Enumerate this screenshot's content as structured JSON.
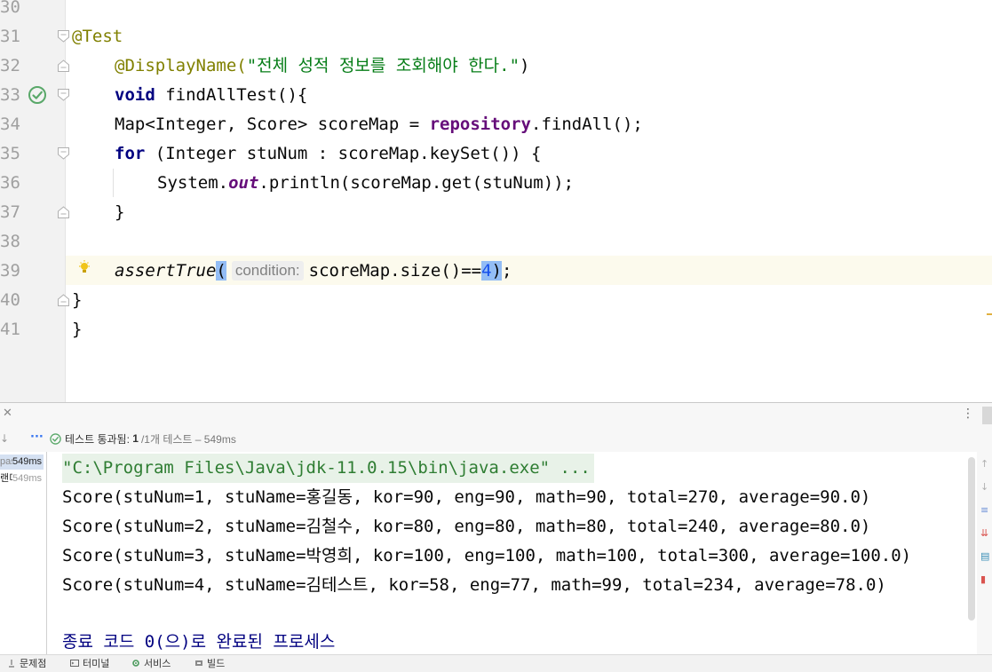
{
  "editor": {
    "line_numbers": [
      "30",
      "31",
      "32",
      "33",
      "34",
      "35",
      "36",
      "37",
      "38",
      "39",
      "40",
      "41"
    ],
    "lines": {
      "l31": {
        "annotation": "@Test"
      },
      "l32": {
        "annotation": "@DisplayName(",
        "string": "\"전체 성적 정보를 조회해야 한다.\"",
        "close": ")"
      },
      "l33": {
        "keyword": "void",
        "rest": " findAllTest(){"
      },
      "l34": {
        "pre": "Map<Integer, Score> scoreMap = ",
        "field": "repository",
        "post": ".findAll();"
      },
      "l35": {
        "keyword": "for",
        "rest": " (Integer stuNum : scoreMap.keySet()) {"
      },
      "l36": {
        "pre": "System.",
        "field": "out",
        "post": ".println(scoreMap.get(stuNum));"
      },
      "l37": {
        "text": "}"
      },
      "l39": {
        "method": "assertTrue",
        "open": "(",
        "hint": "condition:",
        "expr": "scoreMap.size()==",
        "number": "4",
        "close": ")",
        "semi": ";"
      },
      "l40": {
        "text": "}"
      },
      "l41": {
        "text": "}"
      }
    }
  },
  "run_panel": {
    "toolbar": {
      "dots": "···",
      "status_label": "테스트 통과됨:",
      "passed_count": "1",
      "summary": "/1개 테스트 – 549ms"
    },
    "tree": {
      "row1": {
        "name": "pas",
        "time": "549ms"
      },
      "row2": {
        "name": "랜디",
        "time": "549ms"
      }
    },
    "console": {
      "command": "\"C:\\Program Files\\Java\\jdk-11.0.15\\bin\\java.exe\" ...",
      "output": [
        "Score(stuNum=1, stuName=홍길동, kor=90, eng=90, math=90, total=270, average=90.0)",
        "Score(stuNum=2, stuName=김철수, kor=80, eng=80, math=80, total=240, average=80.0)",
        "Score(stuNum=3, stuName=박영희, kor=100, eng=100, math=100, total=300, average=100.0)",
        "Score(stuNum=4, stuName=김테스트, kor=58, eng=77, math=99, total=234, average=78.0)"
      ],
      "exit_message": "종료 코드 0(으)로 완료된 프로세스"
    }
  },
  "statusbar": {
    "problems": "문제점",
    "terminal": "터미널",
    "services": "서비스",
    "build": "빌드"
  },
  "colors": {
    "keyword": "#000080",
    "annotation": "#808000",
    "string": "#067d17",
    "field": "#660e7a",
    "number": "#1750eb",
    "pass_green": "#59a869",
    "caret_line": "#fcfaed"
  },
  "icons": {
    "run_gutter": "test-passed-check-icon",
    "intention": "lightbulb-icon",
    "status_pass": "check-circle-icon"
  }
}
